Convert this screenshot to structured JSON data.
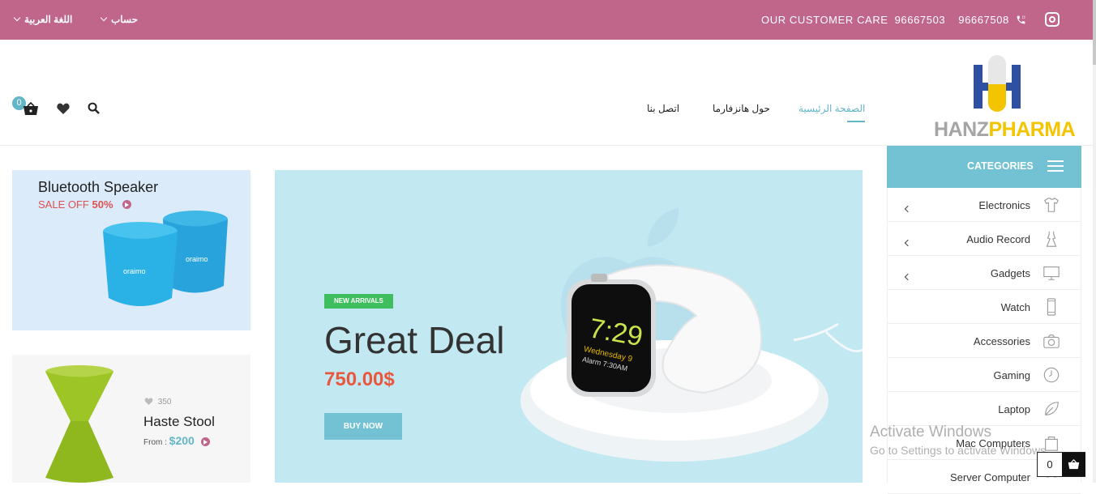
{
  "topbar": {
    "language": "اللغة العربية",
    "account": "حساب",
    "care_label": "OUR CUSTOMER CARE",
    "phone_1": "96667503",
    "phone_2": "96667508"
  },
  "header": {
    "cart_count": "0",
    "nav": {
      "home": "الصفحة الرئيسية",
      "about": "حول هانزفارما",
      "contact": "اتصل بنا"
    },
    "logo": {
      "part1": "HANZ",
      "part2": "PHARMA"
    }
  },
  "categories": {
    "title": "CATEGORIES",
    "items": [
      {
        "label": "Electronics",
        "icon": "tshirt-icon",
        "has_sub": true
      },
      {
        "label": "Audio Record",
        "icon": "dress-icon",
        "has_sub": true
      },
      {
        "label": "Gadgets",
        "icon": "monitor-icon",
        "has_sub": true
      },
      {
        "label": "Watch",
        "icon": "phone-icon",
        "has_sub": false
      },
      {
        "label": "Accessories",
        "icon": "camera-icon",
        "has_sub": false
      },
      {
        "label": "Gaming",
        "icon": "clock-icon",
        "has_sub": false
      },
      {
        "label": "Laptop",
        "icon": "leaf-icon",
        "has_sub": false
      },
      {
        "label": "Mac Computers",
        "icon": "bag-icon",
        "has_sub": false
      },
      {
        "label": "Server Computer",
        "icon": "group-icon",
        "has_sub": false
      }
    ]
  },
  "banners": {
    "speaker": {
      "title": "Bluetooth Speaker",
      "sale_text": "SALE OFF",
      "sale_pct": "50%",
      "brand": "oraimo"
    },
    "stool": {
      "likes": "350",
      "name": "Haste Stool",
      "from": "From :",
      "price": "$200"
    }
  },
  "hero": {
    "tag": "NEW ARRIVALS",
    "title": "Great Deal",
    "price": "750.00$",
    "cta": "BUY NOW",
    "watch_time": "7:29",
    "watch_date": "Wednesday 9",
    "watch_alarm": "Alarm 7:30AM"
  },
  "watermark": {
    "line1": "Activate Windows",
    "line2": "Go to Settings to activate Windows."
  },
  "floating_cart": {
    "count": "0"
  },
  "colors": {
    "topbar": "#c0668b",
    "accent": "#73c2d3",
    "hero_bg": "#c2e8f2",
    "price": "#e9573f",
    "tag": "#3fbe5f"
  }
}
